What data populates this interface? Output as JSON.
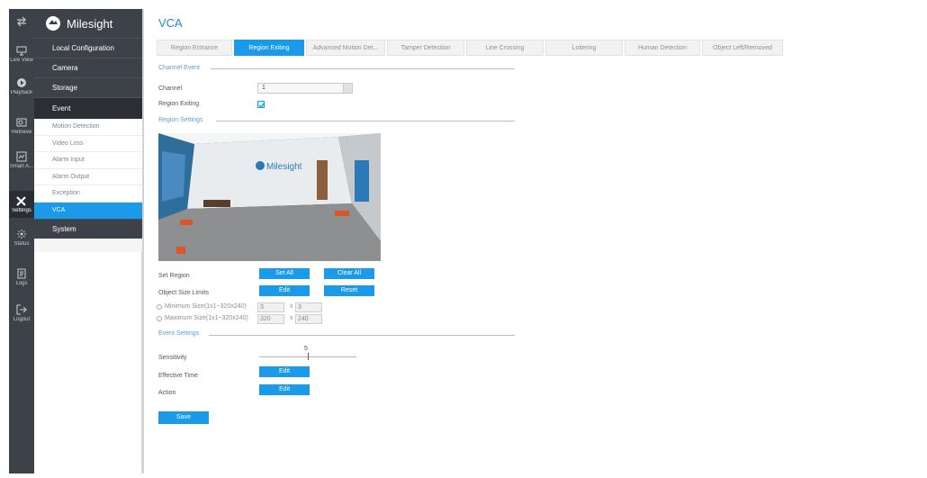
{
  "rail": {
    "items": [
      {
        "label": "",
        "icon": "transfer-arrows-icon"
      },
      {
        "label": "Live View",
        "icon": "live-view-icon"
      },
      {
        "label": "Playback",
        "icon": "playback-icon"
      },
      {
        "label": "Retrieve",
        "icon": "retrieve-icon"
      },
      {
        "label": "Smart A...",
        "icon": "smart-analysis-icon"
      },
      {
        "label": "Settings",
        "icon": "settings-tools-icon"
      },
      {
        "label": "Status",
        "icon": "status-icon"
      },
      {
        "label": "Logs",
        "icon": "logs-icon"
      },
      {
        "label": "Logout",
        "icon": "logout-icon"
      }
    ]
  },
  "brand": {
    "name": "Milesight",
    "icon": "milesight-logo-icon"
  },
  "sidebar": {
    "groups": {
      "local_configuration": "Local Configuration",
      "camera": "Camera",
      "storage": "Storage",
      "event": "Event",
      "system": "System"
    },
    "event_items": [
      "Motion Detection",
      "Video Loss",
      "Alarm Input",
      "Alarm Output",
      "Exception",
      "VCA"
    ]
  },
  "page": {
    "title": "VCA"
  },
  "tabs": [
    "Region Entrance",
    "Region Exiting",
    "Advanced Motion Det...",
    "Tamper Detection",
    "Line Crossing",
    "Loitering",
    "Human Detection",
    "Object Left/Removed"
  ],
  "channel_event": {
    "section_title": "Channel Event",
    "channel_label": "Channel",
    "channel_value": "1",
    "region_exiting_label": "Region Exiting",
    "region_exiting_checked": true
  },
  "region_settings": {
    "section_title": "Region Settings",
    "video_logo_text": "Milesight",
    "set_region_label": "Set Region",
    "set_all": "Set All",
    "clear_all": "Clear All",
    "object_size_label": "Object Size Limits",
    "edit": "Edit",
    "reset": "Reset",
    "min_label": "Minimum Size(1x1~320x240)",
    "min_w": "3",
    "min_h": "3",
    "max_label": "Maximum Size(1x1~320x240)",
    "max_w": "320",
    "max_h": "240",
    "x": "x"
  },
  "event_settings": {
    "section_title": "Event Settings",
    "sensitivity_label": "Sensitivity",
    "sensitivity_value": "5",
    "effective_time_label": "Effective Time",
    "effective_time_btn": "Edit",
    "action_label": "Action",
    "action_btn": "Edit"
  },
  "save": "Save",
  "colors": {
    "accent": "#1a9ae8",
    "dark": "#3d4248",
    "section": "#5a9fd4"
  }
}
